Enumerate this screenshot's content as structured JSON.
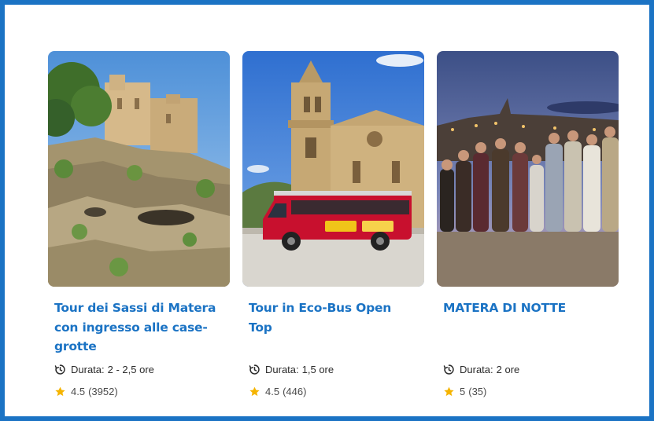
{
  "cards": [
    {
      "title": "Tour dei Sassi di Matera con ingresso alle case-grotte",
      "duration_label": "Durata:",
      "duration_value": "2 - 2,5 ore",
      "rating": "4.5",
      "reviews": "(3952)"
    },
    {
      "title": "Tour in Eco-Bus Open Top",
      "duration_label": "Durata:",
      "duration_value": "1,5 ore",
      "rating": "4.5",
      "reviews": "(446)"
    },
    {
      "title": "MATERA DI NOTTE",
      "duration_label": "Durata:",
      "duration_value": "2 ore",
      "rating": "5",
      "reviews": "(35)"
    }
  ],
  "icons": {
    "duration": "clock-refresh-icon",
    "rating": "star-icon"
  },
  "colors": {
    "frame_border": "#1b73c4",
    "title": "#1b73c4",
    "star": "#f5b400",
    "text": "#2b2b2b"
  }
}
